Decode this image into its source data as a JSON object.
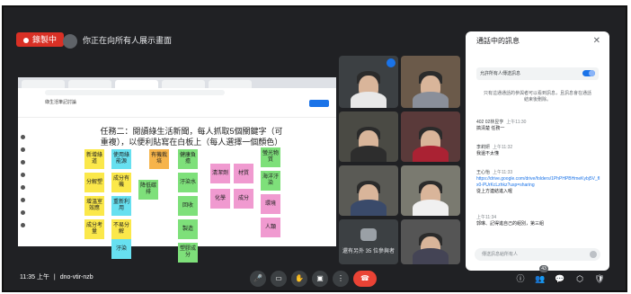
{
  "recording": {
    "label": "錄製中"
  },
  "presenter": {
    "label": "你正在向所有人展示畫面"
  },
  "shared_screen": {
    "doc_title": "綠生活筆記討論",
    "task_title": "任務二：閱讀綠生活新聞，每人抓取5個關鍵字（可重複），以便利貼寫在白板上（每人選擇一個顏色）",
    "notes": [
      {
        "text": "新增綠道",
        "color": "y"
      },
      {
        "text": "分解塑",
        "color": "y"
      },
      {
        "text": "增溫室效應",
        "color": "y"
      },
      {
        "text": "成分考量",
        "color": "y"
      },
      {
        "text": "使用綠能源",
        "color": "c"
      },
      {
        "text": "成分有機",
        "color": "y"
      },
      {
        "text": "重新利用",
        "color": "c"
      },
      {
        "text": "不易分解",
        "color": "y"
      },
      {
        "text": "汙染",
        "color": "c"
      },
      {
        "text": "降低碳排",
        "color": "g"
      },
      {
        "text": "有機栽培",
        "color": "o"
      },
      {
        "text": "健康負擔",
        "color": "g"
      },
      {
        "text": "汙染水",
        "color": "g"
      },
      {
        "text": "回收",
        "color": "g"
      },
      {
        "text": "製造",
        "color": "g"
      },
      {
        "text": "塑膠成分",
        "color": "g"
      },
      {
        "text": "清潔劑",
        "color": "p"
      },
      {
        "text": "材質",
        "color": "p"
      },
      {
        "text": "化學",
        "color": "p"
      },
      {
        "text": "成分",
        "color": "p"
      },
      {
        "text": "螢光物質",
        "color": "g"
      },
      {
        "text": "海洋汙染",
        "color": "g"
      },
      {
        "text": "環境",
        "color": "p"
      },
      {
        "text": "人類",
        "color": "p"
      }
    ]
  },
  "tiles": [
    {
      "name": ""
    },
    {
      "name": ""
    },
    {
      "name": ""
    },
    {
      "name": ""
    },
    {
      "name": ""
    },
    {
      "name": ""
    },
    {
      "name": ""
    }
  ],
  "more_participants": {
    "label": "還有另外 35 位參與者"
  },
  "chat": {
    "title": "通話中的訊息",
    "allow_label": "允許所有人傳送訊息",
    "notice": "只有這通通話的參與者可以看到訊息，且訊息會在通話結束後刪除。",
    "messages": [
      {
        "who": "402 02林昱亨",
        "time": "上午11:30",
        "text": "搞清楚 任務一"
      },
      {
        "who": "李莉妍",
        "time": "上午11:32",
        "text": "我還不太懂"
      },
      {
        "who": "王心怡",
        "time": "上午11:33",
        "text": "",
        "link": "https://drive.google.com/drive/folders/1PhPHPBHmeKybj5V_fIx0-PUrKcLzhkz?usp=sharing",
        "extra": "從上方連結進入喔"
      },
      {
        "who": "",
        "time": "上午11:34",
        "text": "郭琳、記得進自己的組別，第三組"
      }
    ],
    "input_placeholder": "傳送訊息給所有人"
  },
  "meeting": {
    "time": "11:35 上午",
    "code": "dno-vtir-nzb"
  },
  "controls": {
    "mic": "🎤",
    "cam": "▭",
    "hand": "✋",
    "present": "▣",
    "more": "⋮",
    "end": "☎"
  },
  "right_controls": {
    "info": "ⓘ",
    "people": "👥",
    "people_count": "43",
    "chat": "💬",
    "activities": "⬡",
    "safety": "🛡"
  }
}
